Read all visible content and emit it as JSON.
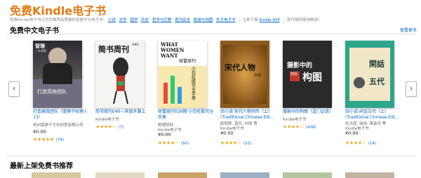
{
  "header": {
    "title": "免费Kindle电子书",
    "subtitle": "免费Kindle电子书以为您推荐高质量的免费中文电子书：",
    "categories": [
      "小说",
      "文学",
      "国学",
      "历史",
      "哲学与宗教",
      "观刊杂志",
      "旅游与地图",
      "外文电子书"
    ],
    "subtitle_suffix": "，立即下载",
    "kindle_app": "Kindle APP",
    "subtitle_end": "，即可随时随地畅读！"
  },
  "section": {
    "title": "免费中文电子书",
    "see_more": "查看更多"
  },
  "nav": {
    "prev": "‹",
    "next": "›"
  },
  "products": [
    {
      "title": "打造高效团队（蓝狮子经理人 13）",
      "author": "杭州蓝狮子文化创意有限公司",
      "price": "¥0.00",
      "stars": "★★★★★",
      "reviews": "(74)",
      "cover_text": [
        "管理",
        "一本就够",
        "打造高效团队"
      ]
    },
    {
      "title": "简书周刊040—来故乡路上",
      "author": "Kindle电子书",
      "price": "¥0.00",
      "stars": "★★★★☆",
      "reviews": "(7)",
      "cover_text": [
        "简书周刊",
        "040"
      ]
    },
    {
      "title": "财富周刊026期·小白吃股完全手册",
      "author": "她理财网",
      "author2": "Kindle电子书",
      "price": "¥0.00",
      "stars": "★★★★☆",
      "reviews": "(50)",
      "cover_text": [
        "WHAT",
        "WOMEN",
        "WANT",
        "财富周刊",
        "小白吃股完全手册"
      ]
    },
    {
      "title": "旧小说·宋代人物列传（上）(Traditional Chinese Edi...",
      "author": "欧阳修, 曾巩, 刘攽 等",
      "author2": "Kindle电子书",
      "price": "¥0.00",
      "stars": "★★★★☆",
      "reviews": "(22)",
      "cover_text": [
        "宋代人物",
        "列傳"
      ]
    },
    {
      "title": "摄影中的构图（逗门证语）",
      "author": "Kindle电子书",
      "price": "",
      "stars": "★★★★☆",
      "reviews": "(438)",
      "cover_text": [
        "摄影中的",
        "构图",
        "前后"
      ]
    },
    {
      "title": "旧小说·闲话五代（上）(Traditional Chinese Edi...",
      "author": "杜光庭, 徐铉, 蒋录光 等",
      "author2": "Kindle电子书",
      "price": "¥0.00",
      "stars": "★★★★☆",
      "reviews": "(14)",
      "cover_text": [
        "閑話",
        "五代"
      ]
    }
  ],
  "section2": {
    "title": "最新上架免费书推荐"
  },
  "colors": {
    "accent": "#e47911",
    "link": "#0066c0",
    "star": "#f0a41c"
  }
}
